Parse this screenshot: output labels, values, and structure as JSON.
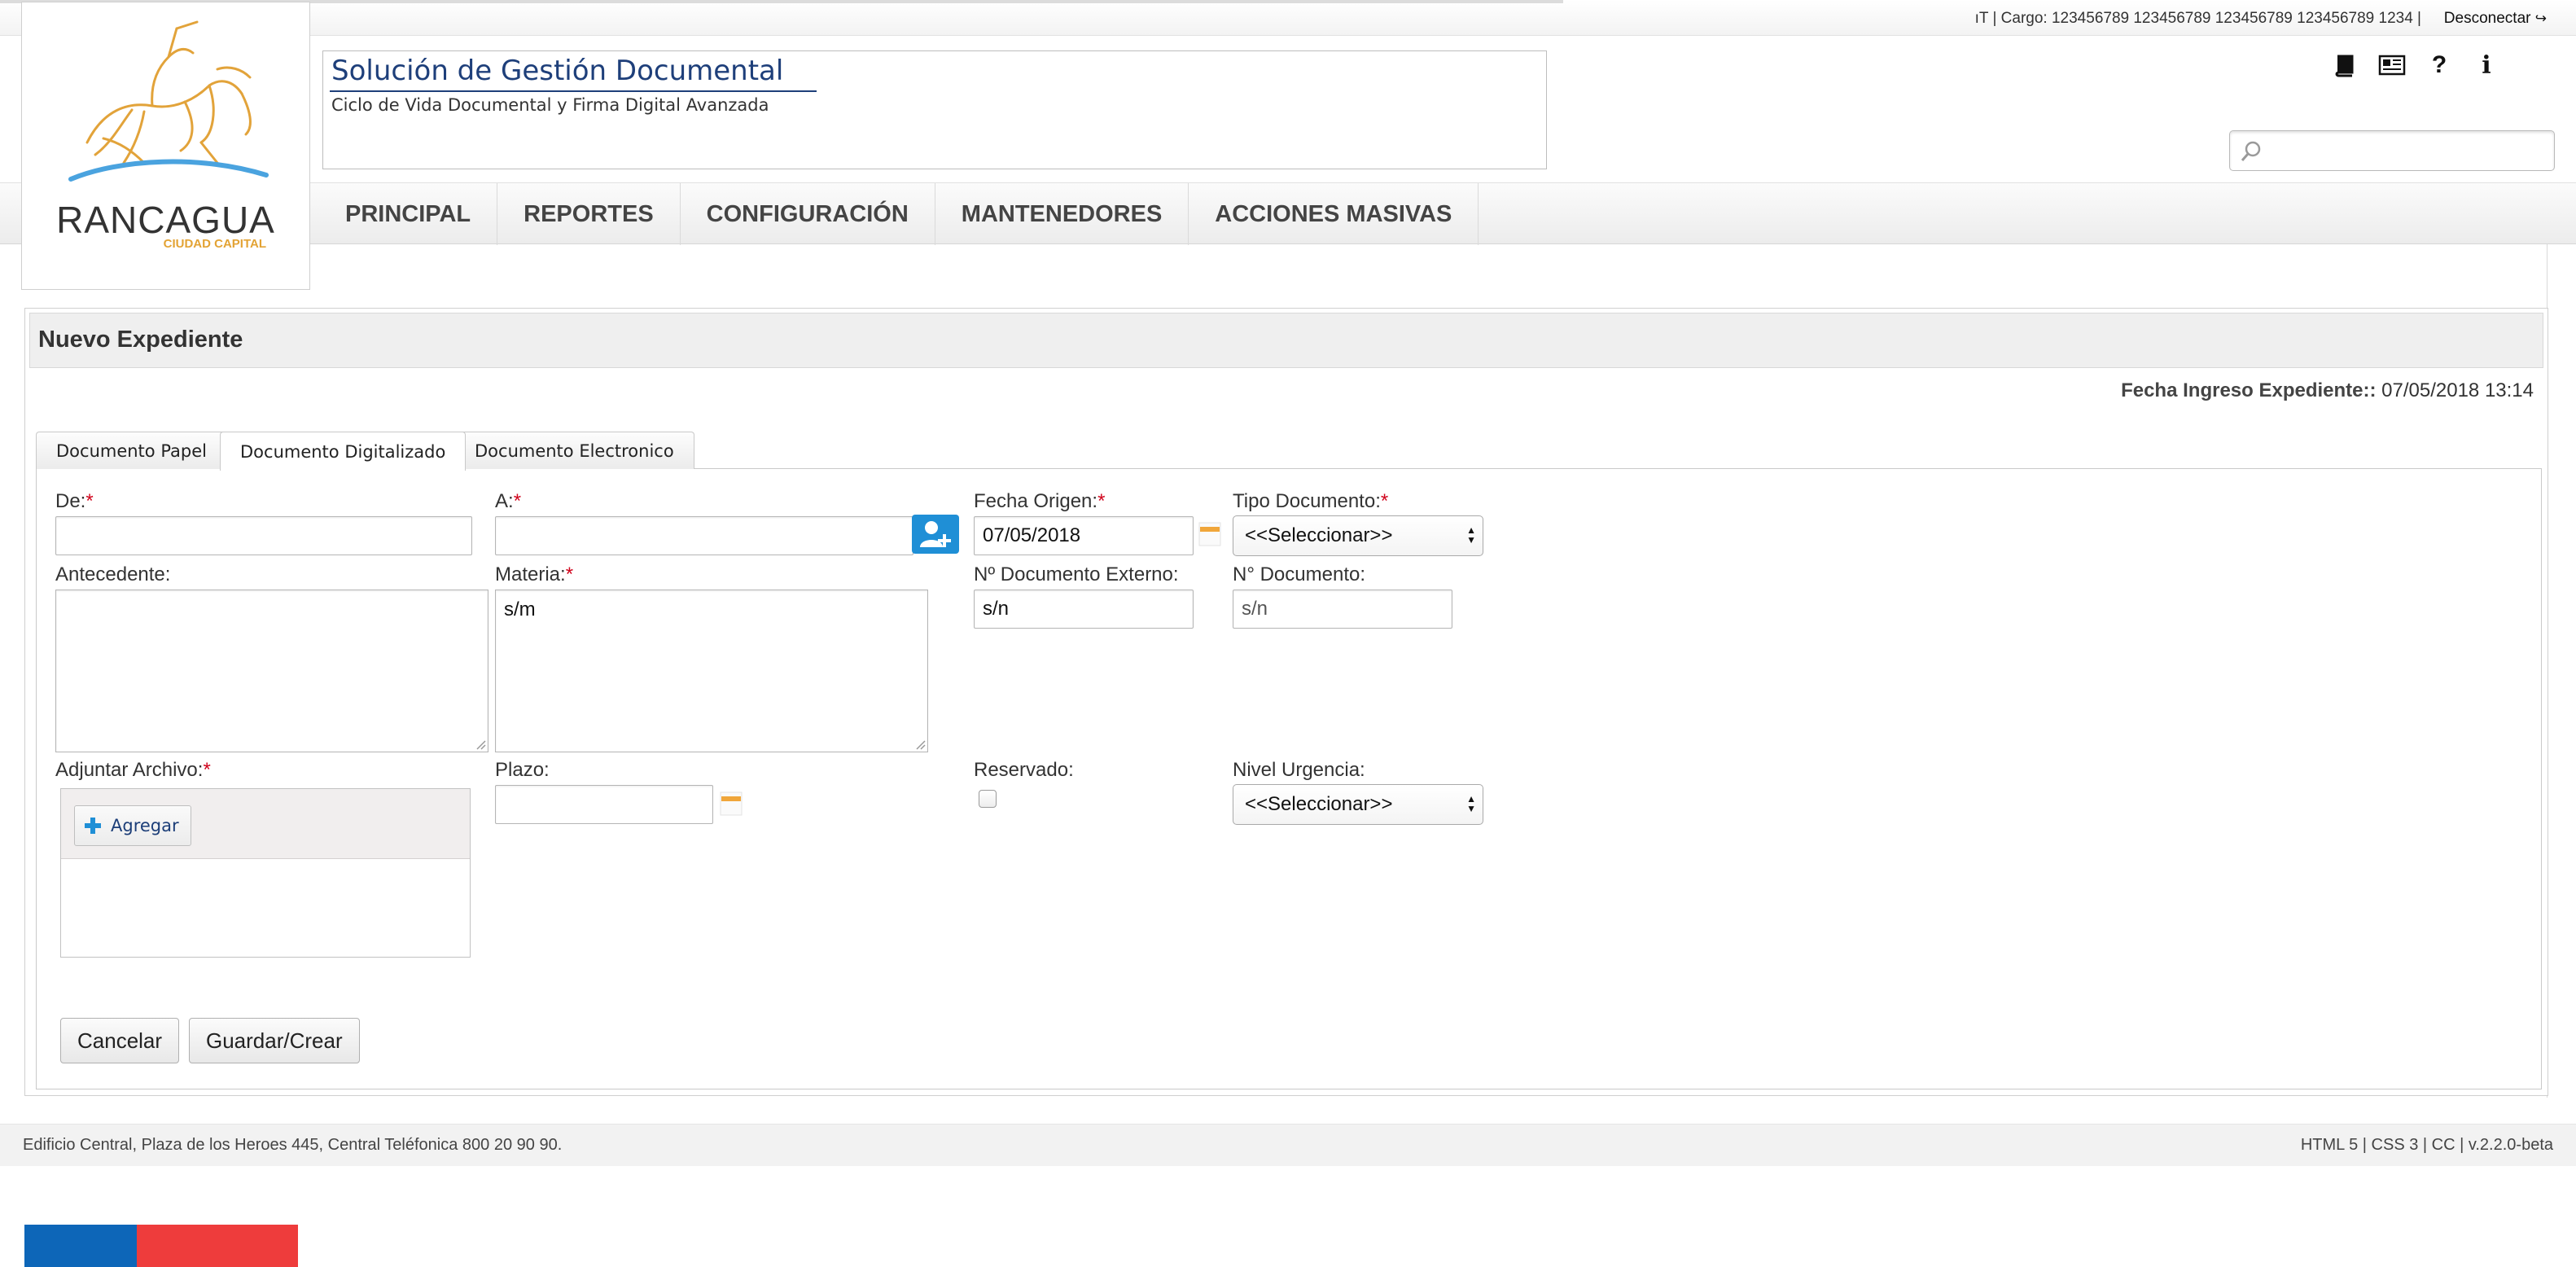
{
  "topbar": {
    "user_info": "ıT | Cargo: 123456789 123456789 123456789 123456789 1234 |",
    "disconnect_label": "Desconectar"
  },
  "logo": {
    "name": "RANCAGUA",
    "subtitle": "CIUDAD CAPITAL"
  },
  "header": {
    "title": "Solución de Gestión Documental",
    "subtitle": "Ciclo de Vida Documental y Firma Digital Avanzada",
    "icons": [
      "book-icon",
      "newspaper-icon",
      "help-icon",
      "info-icon"
    ],
    "search_placeholder": ""
  },
  "nav": {
    "items": [
      "PRINCIPAL",
      "REPORTES",
      "CONFIGURACIÓN",
      "MANTENEDORES",
      "ACCIONES MASIVAS"
    ]
  },
  "panel": {
    "title": "Nuevo Expediente",
    "fecha_label": "Fecha Ingreso Expediente::",
    "fecha_value": "07/05/2018 13:14"
  },
  "tabs": [
    {
      "label": "Documento Papel",
      "active": false
    },
    {
      "label": "Documento Digitalizado",
      "active": true
    },
    {
      "label": "Documento Electronico",
      "active": false
    }
  ],
  "form": {
    "de": {
      "label": "De:",
      "required": "*",
      "value": ""
    },
    "a": {
      "label": "A:",
      "required": "*",
      "value": ""
    },
    "fecha_origen": {
      "label": "Fecha Origen:",
      "required": "*",
      "value": "07/05/2018"
    },
    "tipo_documento": {
      "label": "Tipo Documento:",
      "required": "*",
      "value": "<<Seleccionar>>"
    },
    "antecedente": {
      "label": "Antecedente:",
      "value": ""
    },
    "materia": {
      "label": "Materia:",
      "required": "*",
      "value": "s/m"
    },
    "n_documento_externo": {
      "label": "Nº Documento Externo:",
      "value": "s/n"
    },
    "n_documento": {
      "label": "N° Documento:",
      "placeholder": "s/n"
    },
    "adjuntar_archivo": {
      "label": "Adjuntar Archivo:",
      "required": "*",
      "button": "Agregar"
    },
    "plazo": {
      "label": "Plazo:",
      "value": ""
    },
    "reservado": {
      "label": "Reservado:",
      "checked": false
    },
    "nivel_urgencia": {
      "label": "Nivel Urgencia:",
      "value": "<<Seleccionar>>"
    }
  },
  "buttons": {
    "cancel": "Cancelar",
    "save": "Guardar/Crear"
  },
  "footer": {
    "address": "Edificio Central, Plaza de los Heroes 445, Central Teléfonica 800 20 90 90.",
    "version": "HTML 5 | CSS 3 | CC | v.2.2.0-beta"
  },
  "colors": {
    "brand_blue": "#1e3f7a",
    "accent_button": "#1f8fd6",
    "required": "#d0021b",
    "flag_blue": "#0d66b8",
    "flag_red": "#ee3c3c",
    "calendar": "#f0a63a"
  }
}
